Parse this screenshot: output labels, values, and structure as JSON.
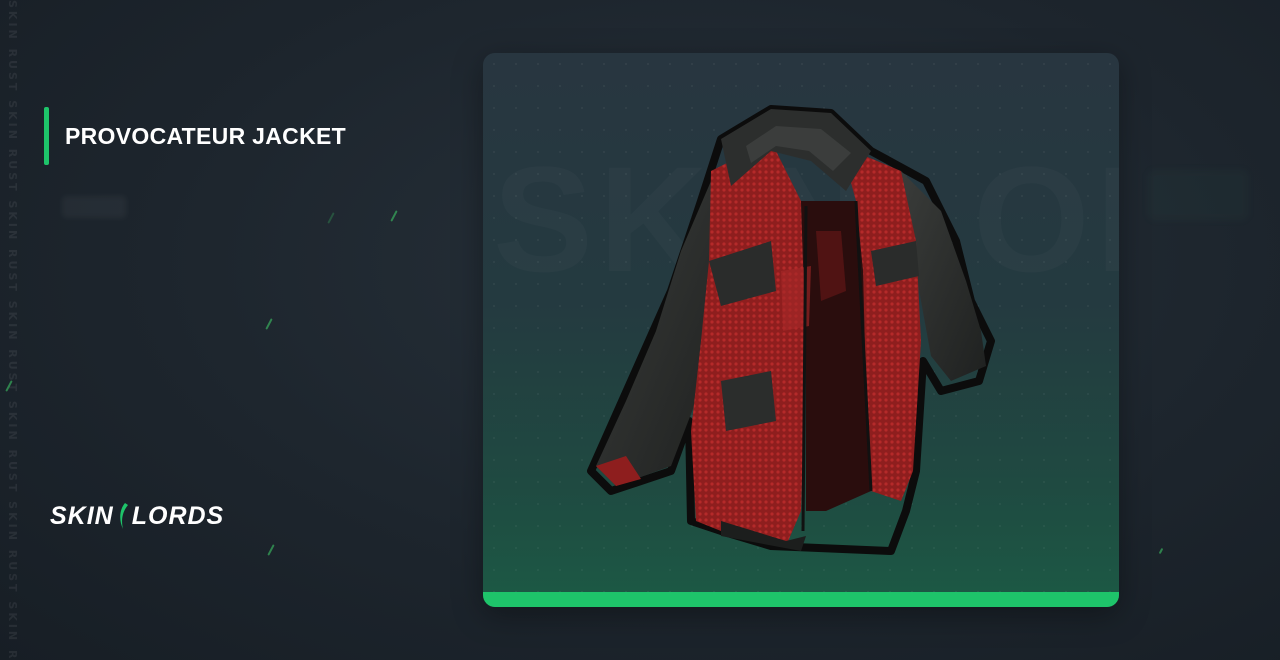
{
  "item": {
    "name": "PROVOCATEUR JACKET"
  },
  "brand": {
    "logo_left": "SKIN",
    "logo_right": "LORDS",
    "accent_color": "#1ec46a"
  },
  "background": {
    "watermark": "SKIN RUST SKIN RUST SKIN RUST SKIN RUST SKIN RUST SKIN RUST SKIN RUST SKIN RUST"
  },
  "icons": {
    "logo_mark": "skinlords-blade-icon",
    "item_image": "jacket-icon"
  }
}
